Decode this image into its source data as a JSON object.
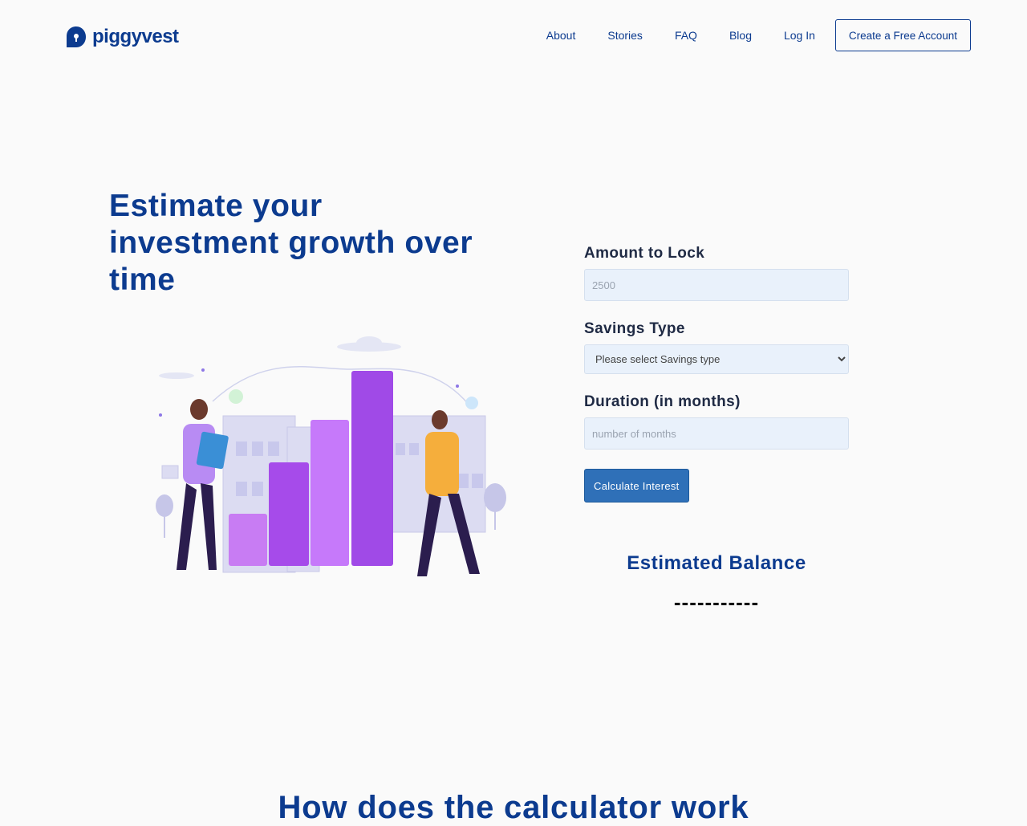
{
  "brand": {
    "name": "piggyvest",
    "color": "#0c3b8f"
  },
  "nav": {
    "links": [
      "About",
      "Stories",
      "FAQ",
      "Blog",
      "Log In"
    ],
    "cta": "Create a Free Account"
  },
  "hero": {
    "title": "Estimate your investment growth over time",
    "illustration_icon": "investment-growth-illustration"
  },
  "form": {
    "amount": {
      "label": "Amount to Lock",
      "placeholder": "2500"
    },
    "savings_type": {
      "label": "Savings Type",
      "selected": "Please select Savings type"
    },
    "duration": {
      "label": "Duration (in months)",
      "placeholder": "number of months"
    },
    "submit": "Calculate Interest",
    "button_color": "#2f70b8",
    "input_bg": "#e9f1fb"
  },
  "result": {
    "title": "Estimated Balance",
    "value": "-----------"
  },
  "section": {
    "title": "How does the calculator work"
  }
}
